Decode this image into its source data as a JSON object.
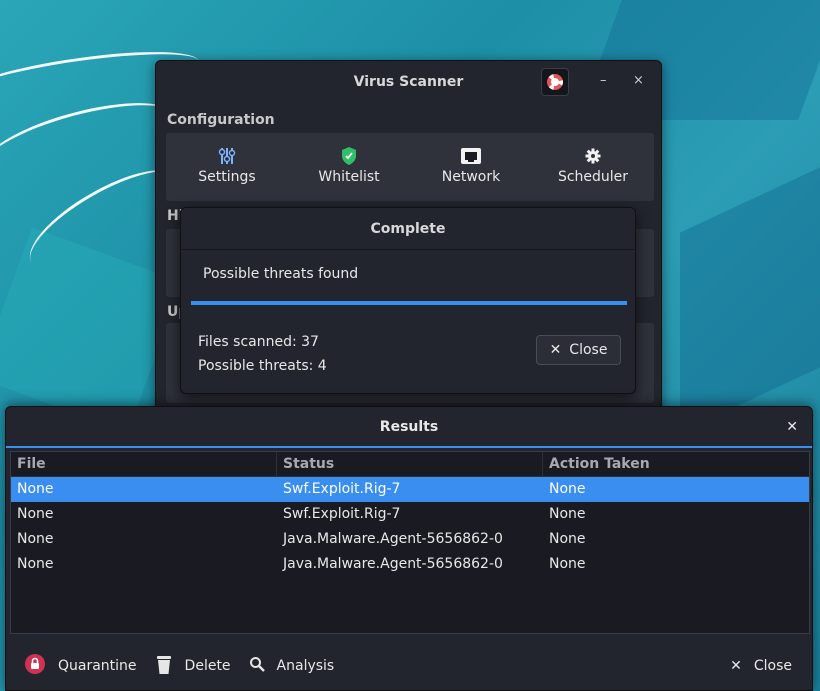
{
  "main_window": {
    "title": "Virus Scanner",
    "minimize_glyph": "–",
    "close_glyph": "×",
    "configuration_label": "Configuration",
    "config_items": [
      {
        "label": "Settings",
        "icon": "sliders-icon"
      },
      {
        "label": "Whitelist",
        "icon": "shield-icon"
      },
      {
        "label": "Network",
        "icon": "ethernet-port-icon"
      },
      {
        "label": "Scheduler",
        "icon": "gear-icon"
      }
    ],
    "history_label": "Hi",
    "update_label": "Up"
  },
  "complete_dialog": {
    "title": "Complete",
    "message": "Possible threats found",
    "progress": 1.0,
    "files_scanned": "Files scanned: 37",
    "possible_threats": "Possible threats: 4",
    "close_label": "Close"
  },
  "results_window": {
    "title": "Results",
    "columns": [
      "File",
      "Status",
      "Action Taken"
    ],
    "rows": [
      [
        "None",
        "Swf.Exploit.Rig-7",
        "None"
      ],
      [
        "None",
        "Swf.Exploit.Rig-7",
        "None"
      ],
      [
        "None",
        "Java.Malware.Agent-5656862-0",
        "None"
      ],
      [
        "None",
        "Java.Malware.Agent-5656862-0",
        "None"
      ]
    ],
    "selected_row": 0,
    "buttons": {
      "quarantine": "Quarantine",
      "delete": "Delete",
      "analysis": "Analysis",
      "close": "Close"
    }
  },
  "colors": {
    "accent": "#3a8ef0",
    "window_bg": "#23252e",
    "quarantine_red": "#d0334f",
    "whitelist_green": "#2fbf6a"
  }
}
